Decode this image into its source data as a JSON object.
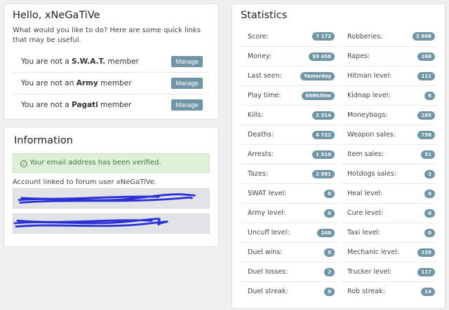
{
  "hello": {
    "title": "Hello, xNeGaTiVe",
    "intro": "What would you like to do? Here are some quick links that may be useful.",
    "memberships": [
      {
        "prefix": "You are not a ",
        "group": "S.W.A.T.",
        "suffix": " member",
        "button": "Manage"
      },
      {
        "prefix": "You are not an ",
        "group": "Army",
        "suffix": " member",
        "button": "Manage"
      },
      {
        "prefix": "You are not a ",
        "group": "Pagati",
        "suffix": " member",
        "button": "Manage"
      }
    ]
  },
  "information": {
    "title": "Information",
    "alert": "Your email address has been verified.",
    "linked_text": "Account linked to forum user xNeGaTiVe.",
    "check_icon": "check-circle-icon",
    "scribble_color": "#2a2fd6"
  },
  "statistics": {
    "title": "Statistics",
    "left": [
      {
        "label": "Score:",
        "value": "7 172"
      },
      {
        "label": "Money:",
        "value": "$9 458"
      },
      {
        "label": "Last seen:",
        "value": "Yesterday"
      },
      {
        "label": "Play time:",
        "value": "668h30m"
      },
      {
        "label": "Kills:",
        "value": "2 314"
      },
      {
        "label": "Deaths:",
        "value": "4 722"
      },
      {
        "label": "Arrests:",
        "value": "1 510"
      },
      {
        "label": "Tazes:",
        "value": "2 981"
      },
      {
        "label": "SWAT level:",
        "value": "0"
      },
      {
        "label": "Army level:",
        "value": "0"
      },
      {
        "label": "Uncuff level:",
        "value": "248"
      },
      {
        "label": "Duel wins:",
        "value": "0"
      },
      {
        "label": "Duel losses:",
        "value": "2"
      },
      {
        "label": "Duel streak:",
        "value": "0"
      }
    ],
    "right": [
      {
        "label": "Robberies:",
        "value": "2 606"
      },
      {
        "label": "Rapes:",
        "value": "160"
      },
      {
        "label": "Hitman level:",
        "value": "111"
      },
      {
        "label": "Kidnap level:",
        "value": "6"
      },
      {
        "label": "Moneybags:",
        "value": "285"
      },
      {
        "label": "Weapon sales:",
        "value": "798"
      },
      {
        "label": "Item sales:",
        "value": "51"
      },
      {
        "label": "Hotdogs sales:",
        "value": "3"
      },
      {
        "label": "Heal level:",
        "value": "0"
      },
      {
        "label": "Cure level:",
        "value": "0"
      },
      {
        "label": "Taxi level:",
        "value": "0"
      },
      {
        "label": "Mechanic level:",
        "value": "158"
      },
      {
        "label": "Trucker level:",
        "value": "117"
      },
      {
        "label": "Rob streak:",
        "value": "14"
      }
    ]
  },
  "colors": {
    "accent": "#6f95a6",
    "success_bg": "#dff0d8",
    "success_text": "#3c763d",
    "page_bg": "#f0f0f0"
  }
}
